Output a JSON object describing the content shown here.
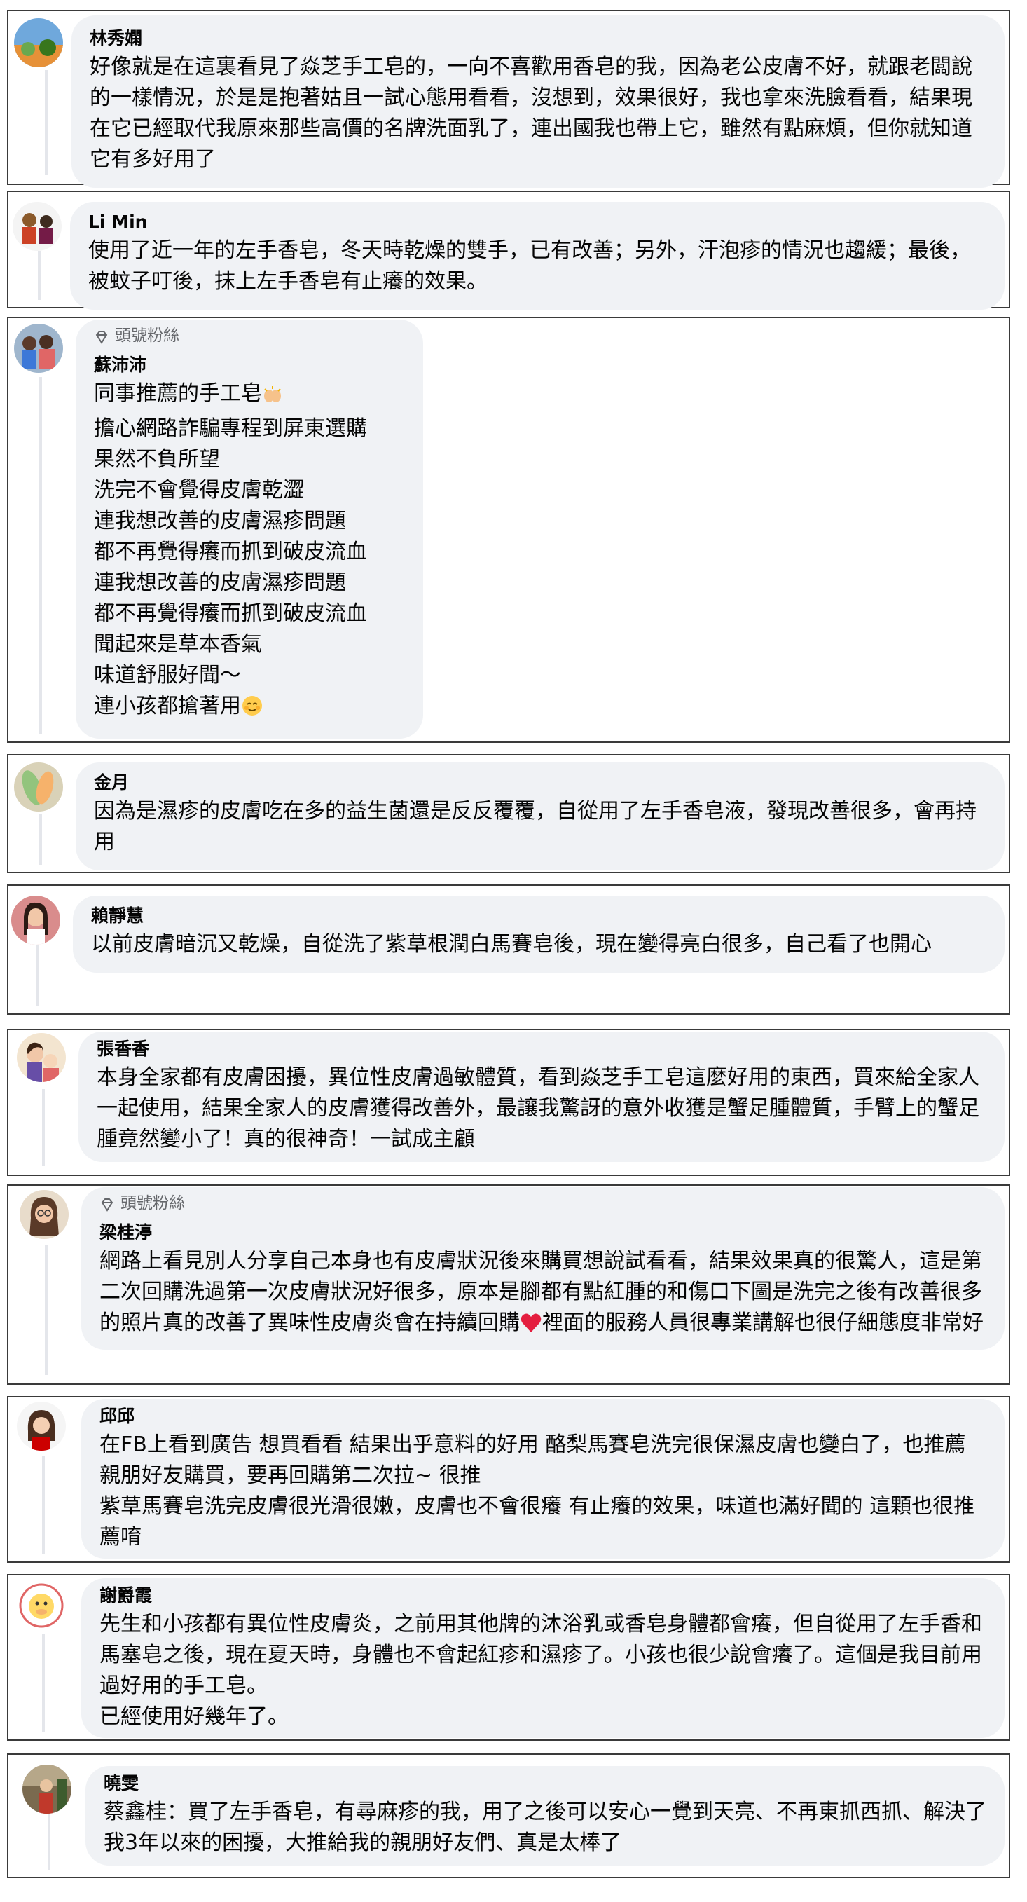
{
  "comments": [
    {
      "name": "林秀嫻",
      "text": "好像就是在這裏看見了焱芝手工皂的，一向不喜歡用香皂的我，因為老公皮膚不好，就跟老闆說的一樣情況，於是是抱著姑且一試心態用看看，沒想到，效果很好，我也拿來洗臉看看，結果現在它已經取代我原來那些高價的名牌洗面乳了，連出國我也帶上它，雖然有點麻煩，但你就知道它有多好用了"
    },
    {
      "name": "Li Min",
      "text": "使用了近一年的左手香皂，冬天時乾燥的雙手，已有改善；另外，汗泡疹的情況也趨緩；最後，被蚊子叮後，抹上左手香皂有止癢的效果。"
    },
    {
      "badge": "頭號粉絲",
      "name": "蘇沛沛",
      "lines": [
        "同事推薦的手工皂",
        "擔心網路詐騙專程到屏東選購",
        "果然不負所望",
        "洗完不會覺得皮膚乾澀",
        "連我想改善的皮膚濕疹問題",
        "都不再覺得癢而抓到破皮流血",
        "連我想改善的皮膚濕疹問題",
        "都不再覺得癢而抓到破皮流血",
        "聞起來是草本香氣",
        "味道舒服好聞～",
        "連小孩都搶著用"
      ]
    },
    {
      "name": "金月",
      "text": "因為是濕疹的皮膚吃在多的益生菌還是反反覆覆，自從用了左手香皂液，發現改善很多，會再持用"
    },
    {
      "name": "賴靜慧",
      "text": "以前皮膚暗沉又乾燥，自從洗了紫草根潤白馬賽皂後，現在變得亮白很多，自己看了也開心"
    },
    {
      "name": "張香香",
      "text": "本身全家都有皮膚困擾，異位性皮膚過敏體質，看到焱芝手工皂這麼好用的東西，買來給全家人一起使用，結果全家人的皮膚獲得改善外，最讓我驚訝的意外收獲是蟹足腫體質，手臂上的蟹足腫竟然變小了！真的很神奇！一試成主顧"
    },
    {
      "badge": "頭號粉絲",
      "name": "梁桂渟",
      "text": "網路上看見別人分享自己本身也有皮膚狀況後來購買想說試看看，結果效果真的很驚人，這是第二次回購洗過第一次皮膚狀況好很多，原本是腳都有點紅腫的和傷口下圖是洗完之後有改善很多的照片真的改善了異味性皮膚炎會在持續回購",
      "text_after": "裡面的服務人員很專業講解也很仔細態度非常好"
    },
    {
      "name": "邱邱",
      "text": "在FB上看到廣告 想買看看 結果出乎意料的好用 酪梨馬賽皂洗完很保濕皮膚也變白了，也推薦親朋好友購買，要再回購第二次拉~ 很推\n紫草馬賽皂洗完皮膚很光滑很嫩，皮膚也不會很癢 有止癢的效果，味道也滿好聞的 這顆也很推薦唷"
    },
    {
      "name": "謝爵霞",
      "text": "先生和小孩都有異位性皮膚炎，之前用其他牌的沐浴乳或香皂身體都會癢，但自從用了左手香和馬塞皂之後，現在夏天時，身體也不會起紅疹和濕疹了。小孩也很少說會癢了。這個是我目前用過好用的手工皂。\n已經使用好幾年了。"
    },
    {
      "name": "曉雯",
      "text": "蔡鑫桂：買了左手香皂，有尋麻疹的我，用了之後可以安心一覺到天亮、不再東抓西抓、解決了我3年以來的困擾，大推給我的親朋好友們、真是太棒了"
    }
  ],
  "emoji": {
    "hands": "raising-hands",
    "face": "relieved-face",
    "heart": "red-heart"
  },
  "colors": {
    "bubble": "#f0f2f5",
    "border": "#3a3a3a",
    "muted": "#65676b",
    "heart": "#e41e3f"
  }
}
